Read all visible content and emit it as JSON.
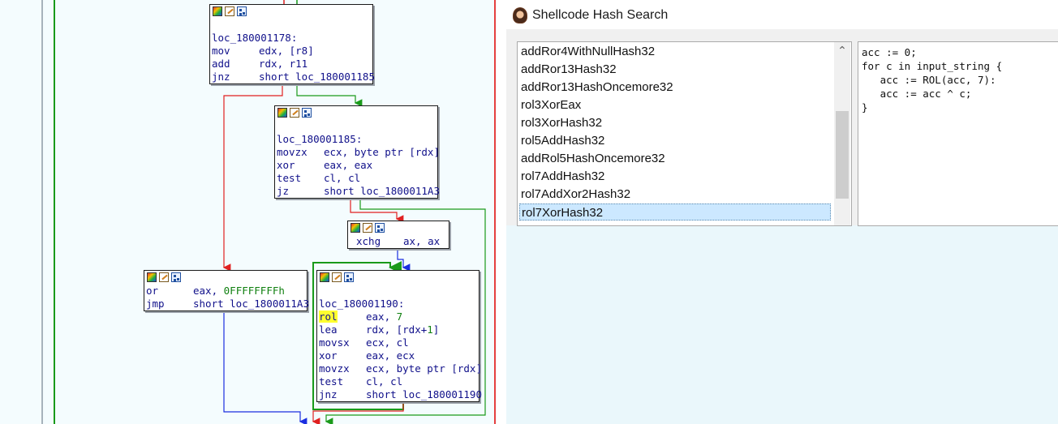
{
  "graph": {
    "block_loc_178": {
      "label": "loc_180001178:",
      "lines": [
        {
          "mn": "mov",
          "op": "edx, [r8]"
        },
        {
          "mn": "add",
          "op": "rdx, r11"
        },
        {
          "mn": "jnz",
          "op": "short loc_180001185"
        }
      ]
    },
    "block_loc_185": {
      "label": "loc_180001185:",
      "lines": [
        {
          "mn": "movzx",
          "op": "ecx, byte ptr [rdx]"
        },
        {
          "mn": "xor",
          "op": "eax, eax"
        },
        {
          "mn": "test",
          "op": "cl, cl"
        },
        {
          "mn": "jz",
          "op": "short loc_1800011A3"
        }
      ]
    },
    "block_xchg": {
      "lines": [
        {
          "mn": "xchg",
          "op": "ax, ax"
        }
      ]
    },
    "block_or": {
      "lines": [
        {
          "mn": "or",
          "op_pre": "eax, ",
          "op_num": "0FFFFFFFFh"
        },
        {
          "mn": "jmp",
          "op": "short loc_1800011A3"
        }
      ]
    },
    "block_loc_190": {
      "label": "loc_180001190:",
      "lines": [
        {
          "mn": "rol",
          "op_pre": "eax, ",
          "op_num": "7"
        },
        {
          "mn": "lea",
          "op_pre": "rdx, [rdx+",
          "op_num": "1",
          "op_post": "]"
        },
        {
          "mn": "movsx",
          "op": "ecx, cl"
        },
        {
          "mn": "xor",
          "op": "eax, ecx"
        },
        {
          "mn": "movzx",
          "op": "ecx, byte ptr [rdx]"
        },
        {
          "mn": "test",
          "op": "cl, cl"
        },
        {
          "mn": "jnz",
          "op": "short loc_180001190"
        }
      ]
    },
    "colors": {
      "true_edge": "#1a9a1a",
      "false_edge": "#e02020",
      "uncond_edge": "#1a2ee0",
      "highlight": "#ffff30"
    }
  },
  "panel": {
    "title": "Shellcode Hash Search",
    "list": {
      "items": [
        "addRor4WithNullHash32",
        "addRor13Hash32",
        "addRor13HashOncemore32",
        "rol3XorEax",
        "rol3XorHash32",
        "rol5AddHash32",
        "addRol5HashOncemore32",
        "rol7AddHash32",
        "rol7AddXor2Hash32",
        "rol7XorHash32"
      ],
      "selected": "rol7XorHash32",
      "scroll_up_icon": "chevron-up-icon"
    },
    "code": "acc := 0;\nfor c in input_string {\n   acc := ROL(acc, 7):\n   acc := acc ^ c;\n}"
  }
}
